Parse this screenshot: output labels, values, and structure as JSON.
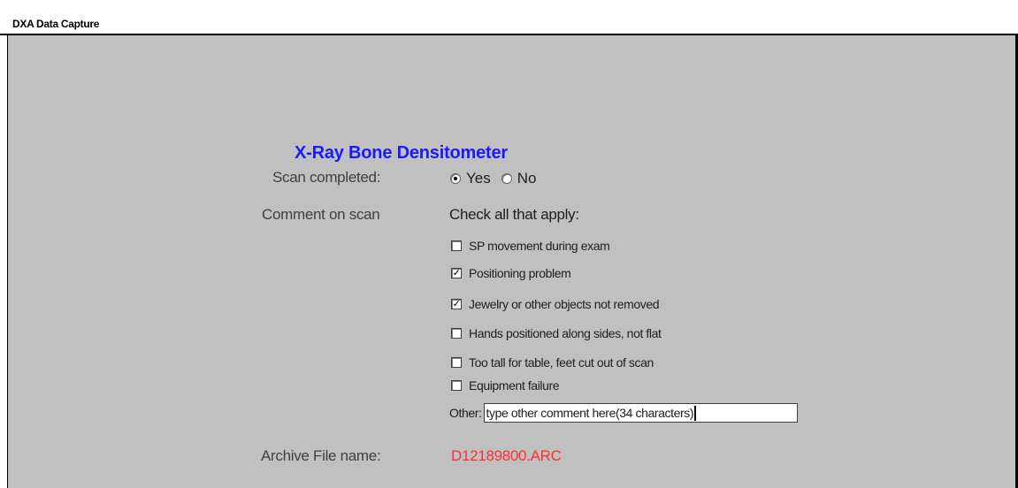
{
  "window": {
    "title": "DXA Data Capture"
  },
  "form": {
    "heading": "X-Ray Bone Densitometer",
    "scan_completed": {
      "label": "Scan completed:",
      "options": [
        "Yes",
        "No"
      ],
      "selected": "Yes"
    },
    "comment": {
      "label": "Comment on scan",
      "instruction": "Check all that apply:",
      "items": [
        {
          "label": "SP movement during exam",
          "checked": false
        },
        {
          "label": "Positioning problem",
          "checked": true
        },
        {
          "label": "Jewelry or other objects not removed",
          "checked": true
        },
        {
          "label": "Hands positioned along sides, not flat",
          "checked": false
        },
        {
          "label": "Too tall for table, feet cut out of scan",
          "checked": false
        },
        {
          "label": "Equipment failure",
          "checked": false
        }
      ],
      "other_label": "Other:",
      "other_value": "type other comment here(34 characters)"
    },
    "archive": {
      "label": "Archive File name:",
      "value": "D12189800.ARC"
    }
  },
  "colors": {
    "background": "#c0c0c0",
    "heading": "#1a1aff",
    "archive_value": "#ff3030"
  }
}
